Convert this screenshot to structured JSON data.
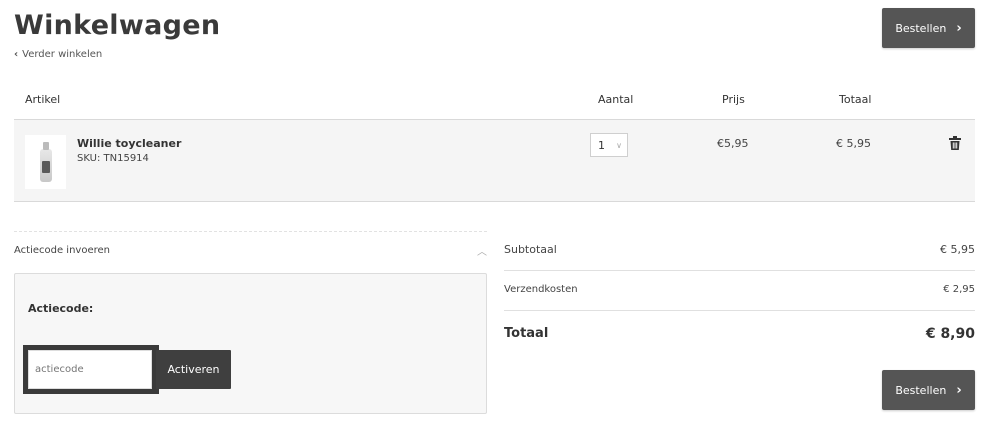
{
  "header": {
    "title": "Winkelwagen",
    "back_link": "Verder winkelen",
    "order_button": "Bestellen"
  },
  "table": {
    "columns": [
      "Artikel",
      "Aantal",
      "Prijs",
      "Totaal"
    ]
  },
  "cart_items": [
    {
      "name": "Willie toycleaner",
      "sku": "SKU: TN15914",
      "quantity": "1",
      "price": "€5,95",
      "total": "€ 5,95",
      "image_icon": "spray-bottle-icon"
    }
  ],
  "promo": {
    "toggle_label": "Actiecode invoeren",
    "field_label": "Actiecode:",
    "input_placeholder": "actiecode",
    "input_value": "",
    "activate_button": "Activeren"
  },
  "summary": {
    "subtotal_label": "Subtotaal",
    "subtotal_value": "€ 5,95",
    "shipping_label": "Verzendkosten",
    "shipping_value": "€ 2,95",
    "total_label": "Totaal",
    "total_value": "€ 8,90",
    "order_button": "Bestellen"
  },
  "colors": {
    "button_bg": "#555555",
    "row_bg": "#f5f5f5",
    "highlight_border": "#3a3a3a"
  }
}
